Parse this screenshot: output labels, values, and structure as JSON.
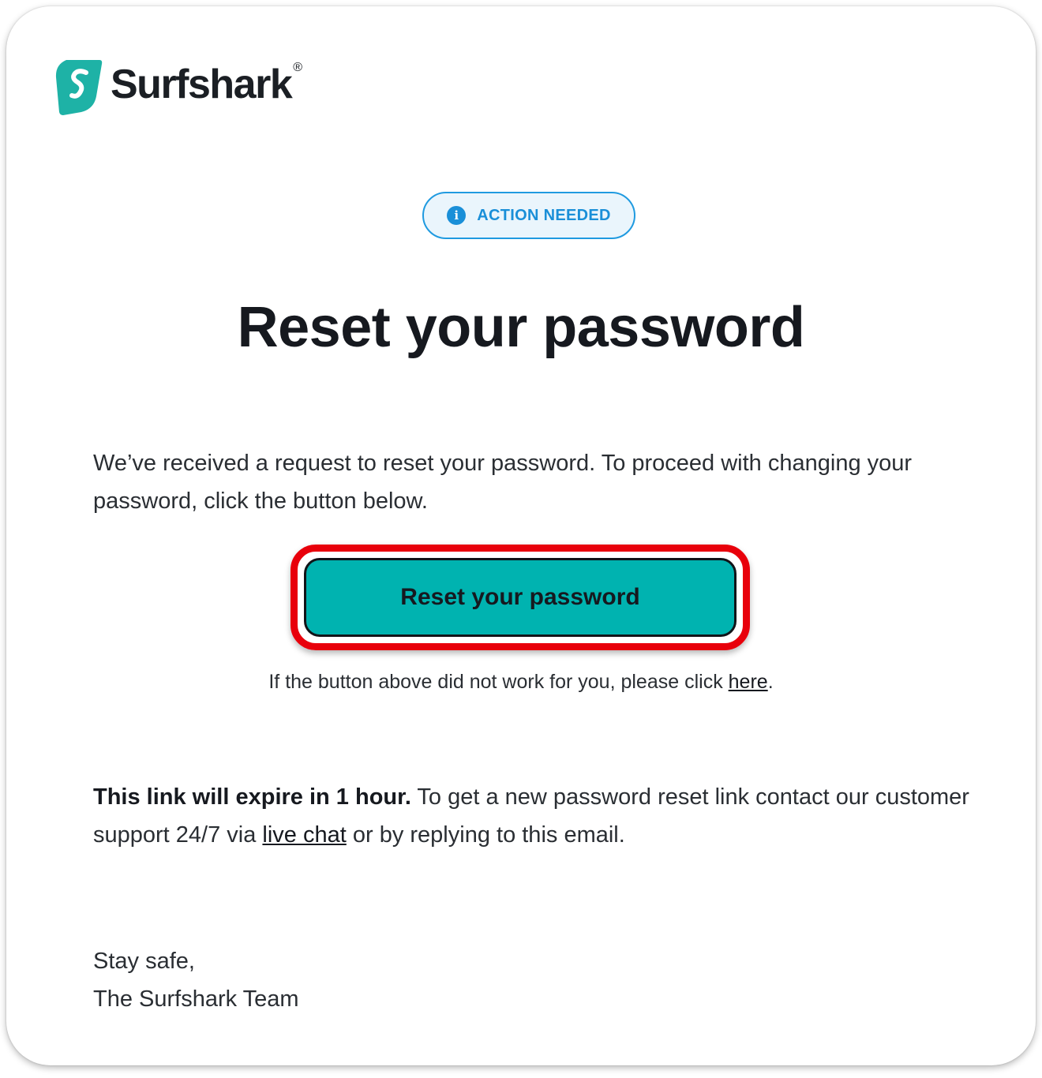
{
  "brand": {
    "name": "Surfshark",
    "registered_mark": "®",
    "color": "#1eb2a6"
  },
  "badge": {
    "icon": "info-icon",
    "icon_glyph": "i",
    "label": "ACTION NEEDED",
    "color": "#1a8fd8"
  },
  "title": "Reset your password",
  "intro": "We’ve received a request to reset your password. To proceed with changing your password, click the button below.",
  "cta": {
    "label": "Reset your password",
    "color": "#00b3b0",
    "highlight_color": "#e8000b"
  },
  "fallback": {
    "prefix": "If the button above did not work for you, please click ",
    "link_label": "here",
    "suffix": "."
  },
  "expiry": {
    "bold": "This link will expire in 1 hour.",
    "text_before_link": " To get a new password reset link contact our customer support 24/7 via ",
    "link_label": "live chat",
    "text_after_link": " or by replying to this email."
  },
  "signoff": {
    "line1": "Stay safe,",
    "line2": "The Surfshark Team"
  }
}
